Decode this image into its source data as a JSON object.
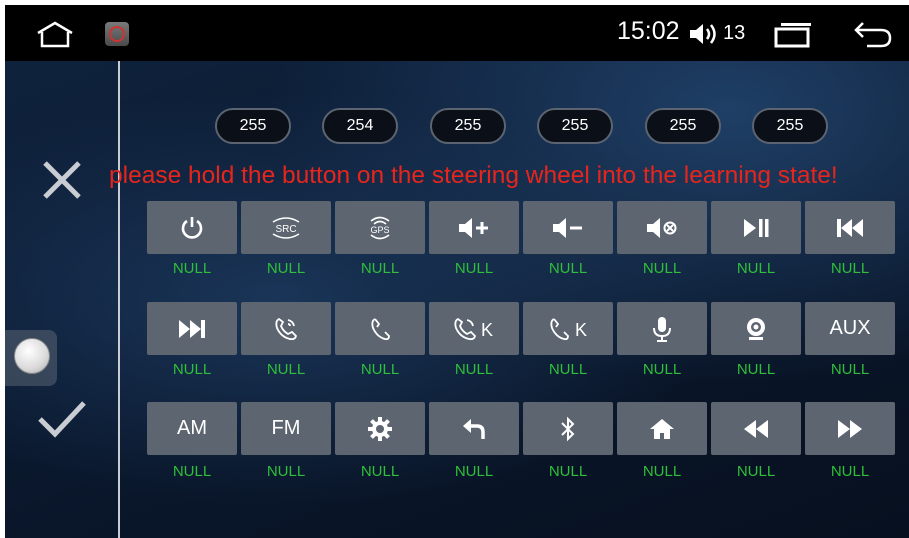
{
  "status_bar": {
    "time": "15:02",
    "volume": "13",
    "icons": [
      "home-icon",
      "app-steering-icon",
      "volume-icon",
      "recent-apps-icon",
      "back-icon"
    ]
  },
  "codes": [
    "255",
    "254",
    "255",
    "255",
    "255",
    "255"
  ],
  "hint": "please hold the button on the steering wheel into the learning state!",
  "left_panel": {
    "icons": [
      "close-icon",
      "toggle-knob",
      "check-icon"
    ]
  },
  "keys": [
    {
      "icon": "power-icon",
      "text": "",
      "label": "NULL"
    },
    {
      "icon": "src-icon",
      "text": "SRC",
      "label": "NULL"
    },
    {
      "icon": "gps-icon",
      "text": "GPS",
      "label": "NULL"
    },
    {
      "icon": "volume-up-icon",
      "text": "",
      "label": "NULL"
    },
    {
      "icon": "volume-down-icon",
      "text": "",
      "label": "NULL"
    },
    {
      "icon": "mute-icon",
      "text": "",
      "label": "NULL"
    },
    {
      "icon": "play-pause-icon",
      "text": "",
      "label": "NULL"
    },
    {
      "icon": "previous-track-icon",
      "text": "",
      "label": "NULL"
    },
    {
      "icon": "next-track-icon",
      "text": "",
      "label": "NULL"
    },
    {
      "icon": "call-answer-icon",
      "text": "",
      "label": "NULL"
    },
    {
      "icon": "call-hangup-icon",
      "text": "",
      "label": "NULL"
    },
    {
      "icon": "call-k-icon",
      "text": "K",
      "label": "NULL"
    },
    {
      "icon": "hangup-k-icon",
      "text": "K",
      "label": "NULL"
    },
    {
      "icon": "microphone-icon",
      "text": "",
      "label": "NULL"
    },
    {
      "icon": "camera-icon",
      "text": "",
      "label": "NULL"
    },
    {
      "icon": "",
      "text": "AUX",
      "label": "NULL"
    },
    {
      "icon": "",
      "text": "AM",
      "label": "NULL"
    },
    {
      "icon": "",
      "text": "FM",
      "label": "NULL"
    },
    {
      "icon": "settings-gear-icon",
      "text": "",
      "label": "NULL"
    },
    {
      "icon": "return-icon",
      "text": "",
      "label": "NULL"
    },
    {
      "icon": "bluetooth-icon",
      "text": "",
      "label": "NULL"
    },
    {
      "icon": "home-icon",
      "text": "",
      "label": "NULL"
    },
    {
      "icon": "rewind-icon",
      "text": "",
      "label": "NULL"
    },
    {
      "icon": "fast-forward-icon",
      "text": "",
      "label": "NULL"
    }
  ]
}
